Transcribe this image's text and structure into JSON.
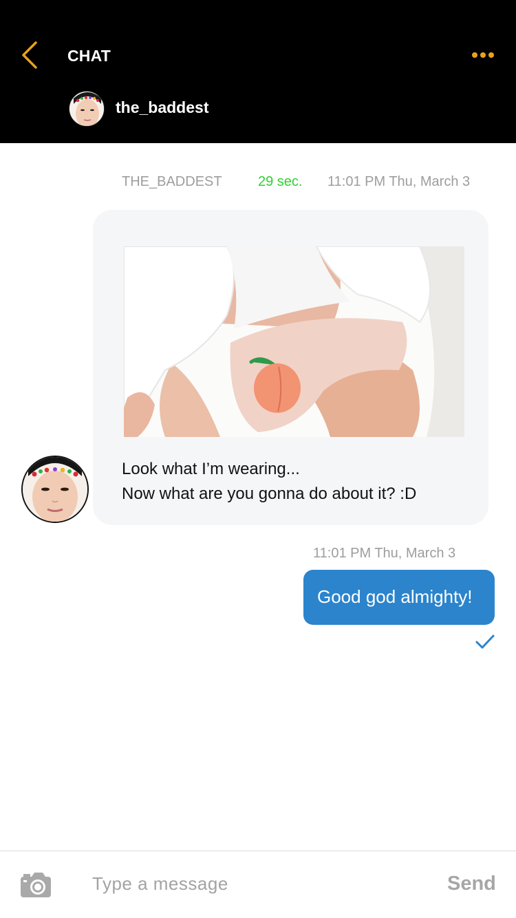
{
  "header": {
    "back_icon": "chevron-left-icon",
    "title": "CHAT",
    "more_icon": "ellipsis-icon",
    "username": "the_baddest",
    "accent_color": "#e8a21a"
  },
  "conversation": {
    "received": {
      "sender": "THE_BADDEST",
      "timer": "29 sec.",
      "timestamp": "11:01 PM Thu, March 3",
      "lines": [
        "Look what I’m wearing...",
        "Now what are you gonna do about it? :D"
      ],
      "timer_color": "#2fd12f"
    },
    "sent": {
      "timestamp": "11:01 PM Thu, March 3",
      "text": "Good god almighty!",
      "status_icon": "checkmark-icon",
      "bubble_color": "#2b84cc"
    }
  },
  "composer": {
    "camera_icon": "camera-icon",
    "placeholder": "Type a message",
    "send_label": "Send"
  }
}
